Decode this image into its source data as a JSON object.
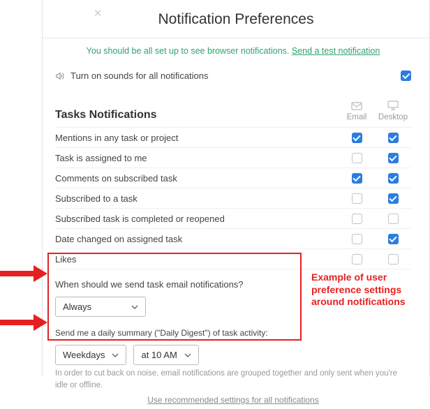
{
  "title": "Notification Preferences",
  "banner": {
    "text": "You should be all set up to see browser notifications. ",
    "link": "Send a test notification"
  },
  "sounds_label": "Turn on sounds for all notifications",
  "sounds_checked": true,
  "section_title": "Tasks Notifications",
  "cols": {
    "email": "Email",
    "desktop": "Desktop"
  },
  "rows": [
    {
      "label": "Mentions in any task or project",
      "email": true,
      "desktop": true
    },
    {
      "label": "Task is assigned to me",
      "email": false,
      "desktop": true
    },
    {
      "label": "Comments on subscribed task",
      "email": true,
      "desktop": true
    },
    {
      "label": "Subscribed to a task",
      "email": false,
      "desktop": true
    },
    {
      "label": "Subscribed task is completed or reopened",
      "email": false,
      "desktop": false
    },
    {
      "label": "Date changed on assigned task",
      "email": false,
      "desktop": true
    },
    {
      "label": "Likes",
      "email": false,
      "desktop": false
    }
  ],
  "timing": {
    "question": "When should we send task email notifications?",
    "select_value": "Always",
    "digest_prompt": "Send me a daily summary (\"Daily Digest\") of task activity:",
    "digest_days": "Weekdays",
    "digest_time": "at 10 AM"
  },
  "footnote": "In order to cut back on noise, email notifications are grouped together and only sent when you're idle or offline.",
  "rec_link": "Use recommended settings for all notifications",
  "annotation": "Example of user preference settings around notifications"
}
